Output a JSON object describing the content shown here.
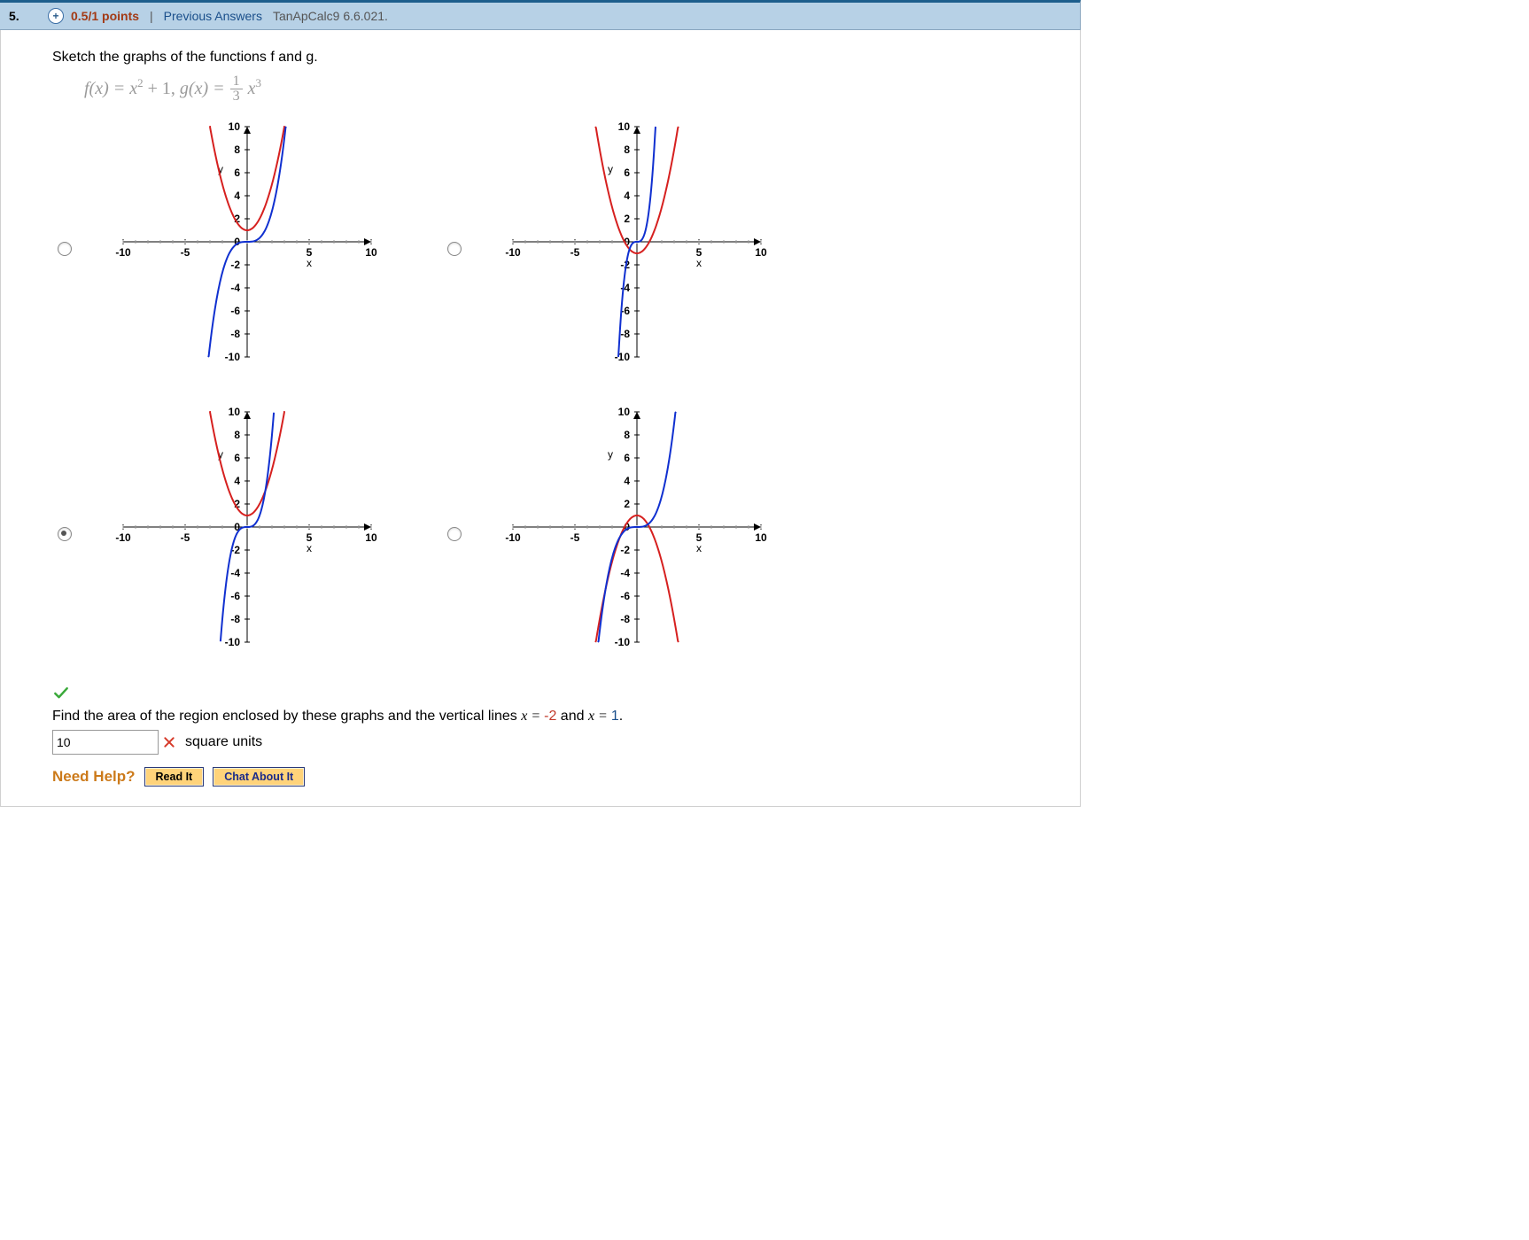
{
  "header": {
    "number": "5.",
    "expand_glyph": "+",
    "points": "0.5/1 points",
    "separator": "|",
    "prev_answers": "Previous Answers",
    "reference": "TanApCalc9 6.6.021."
  },
  "prompt": "Sketch the graphs of the functions f and g.",
  "formula": {
    "f_lhs": "f(x) = x",
    "f_exp": "2",
    "f_plus": " + 1, ",
    "g_lhs": "g(x) = ",
    "frac_num": "1",
    "frac_den": "3",
    "g_tail": "x",
    "g_exp": "3"
  },
  "chart_data": [
    {
      "type": "line",
      "title": "",
      "xlabel": "x",
      "ylabel": "y",
      "xlim": [
        -10,
        10
      ],
      "ylim": [
        -10,
        10
      ],
      "xticks": [
        -10,
        -5,
        0,
        5,
        10
      ],
      "yticks": [
        -10,
        -8,
        -6,
        -4,
        -2,
        0,
        2,
        4,
        6,
        8,
        10
      ],
      "series": [
        {
          "name": "f",
          "color": "red",
          "formula": "x^2 + 1"
        },
        {
          "name": "g",
          "color": "blue",
          "formula": "(1/3)*x^3"
        }
      ],
      "selected": false
    },
    {
      "type": "line",
      "title": "",
      "xlabel": "x",
      "ylabel": "y",
      "xlim": [
        -10,
        10
      ],
      "ylim": [
        -10,
        10
      ],
      "xticks": [
        -10,
        -5,
        0,
        5,
        10
      ],
      "yticks": [
        -10,
        -8,
        -6,
        -4,
        -2,
        0,
        2,
        4,
        6,
        8,
        10
      ],
      "series": [
        {
          "name": "f",
          "color": "red",
          "formula": "x^2 - 1"
        },
        {
          "name": "g",
          "color": "blue",
          "formula": "3*x^3"
        }
      ],
      "selected": false
    },
    {
      "type": "line",
      "title": "",
      "xlabel": "x",
      "ylabel": "y",
      "xlim": [
        -10,
        10
      ],
      "ylim": [
        -10,
        10
      ],
      "xticks": [
        -10,
        -5,
        0,
        5,
        10
      ],
      "yticks": [
        -10,
        -8,
        -6,
        -4,
        -2,
        0,
        2,
        4,
        6,
        8,
        10
      ],
      "series": [
        {
          "name": "f",
          "color": "red",
          "formula": "x^2 + 1"
        },
        {
          "name": "g",
          "color": "blue",
          "formula": "x^3"
        }
      ],
      "selected": true
    },
    {
      "type": "line",
      "title": "",
      "xlabel": "x",
      "ylabel": "y",
      "xlim": [
        -10,
        10
      ],
      "ylim": [
        -10,
        10
      ],
      "xticks": [
        -10,
        -5,
        0,
        5,
        10
      ],
      "yticks": [
        -10,
        -8,
        -6,
        -4,
        -2,
        0,
        2,
        4,
        6,
        8,
        10
      ],
      "series": [
        {
          "name": "f",
          "color": "red",
          "formula": "-x^2 + 1"
        },
        {
          "name": "g",
          "color": "blue",
          "formula": "(1/3)*x^3"
        }
      ],
      "selected": false
    }
  ],
  "find_text": {
    "pre": "Find the area of the region enclosed by these graphs and the vertical lines ",
    "x1_lhs": "x = ",
    "x1_val": "-2",
    "mid": " and ",
    "x2_lhs": "x = ",
    "x2_val": "1",
    "post": "."
  },
  "answer": {
    "value": "10",
    "units": "square units"
  },
  "help": {
    "label": "Need Help?",
    "read": "Read It",
    "chat": "Chat About It"
  }
}
